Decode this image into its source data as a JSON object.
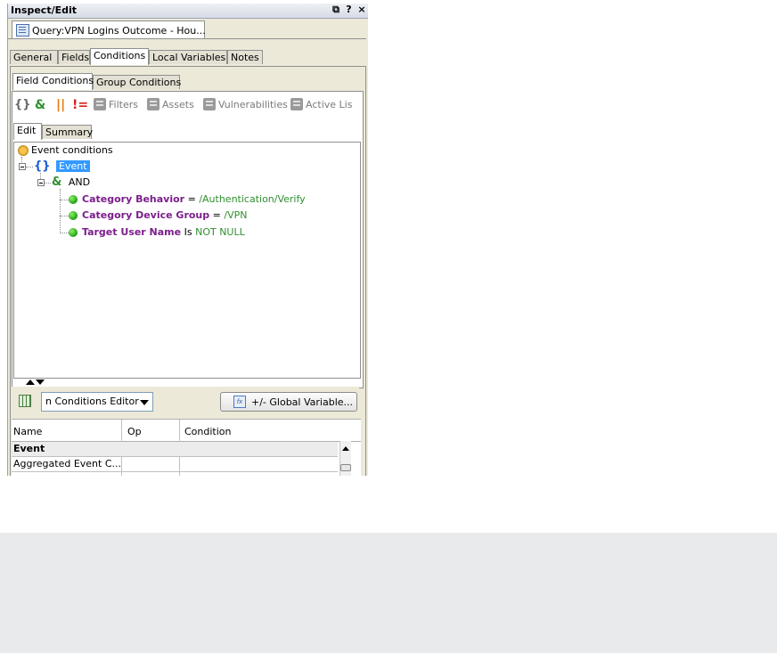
{
  "window": {
    "title": "Inspect/Edit",
    "controls": [
      "⧉",
      "?",
      "×"
    ]
  },
  "document_tab": {
    "label": "Query:VPN Logins Outcome - Hou..."
  },
  "main_tabs": [
    {
      "label": "General",
      "active": false
    },
    {
      "label": "Fields",
      "active": false
    },
    {
      "label": "Conditions",
      "active": true
    },
    {
      "label": "Local Variables",
      "active": false
    },
    {
      "label": "Notes",
      "active": false
    }
  ],
  "condition_tabs": [
    {
      "label": "Field Conditions",
      "active": true
    },
    {
      "label": "Group Conditions",
      "active": false
    }
  ],
  "toolbar": {
    "braces_glyph": "{}",
    "and_glyph": "&",
    "or_glyph": "||",
    "not_glyph": "!=",
    "filters_label": "Filters",
    "assets_label": "Assets",
    "vulnerabilities_label": "Vulnerabilities",
    "active_lists_label": "Active Lis"
  },
  "edit_tabs": [
    {
      "label": "Edit",
      "active": true
    },
    {
      "label": "Summary",
      "active": false
    }
  ],
  "tree": {
    "root_label": "Event conditions",
    "event_glyph": "{}",
    "event_label": "Event",
    "and_glyph": "&",
    "and_label": "AND",
    "conditions": [
      {
        "field": "Category Behavior",
        "op": "=",
        "value": "/Authentication/Verify"
      },
      {
        "field": "Category Device Group",
        "op": "=",
        "value": "/VPN"
      },
      {
        "field": "Target User Name",
        "op": "Is",
        "value": "NOT NULL"
      }
    ]
  },
  "bottom": {
    "editor_selector": "n Conditions Editor",
    "global_variable_button": "+/- Global Variable...",
    "global_variable_icon": "fx"
  },
  "grid": {
    "columns": [
      "Name",
      "Op",
      "Condition"
    ],
    "group_label": "Event",
    "rows": [
      {
        "name": "Aggregated Event C...",
        "op": "",
        "condition": ""
      }
    ]
  },
  "colors": {
    "field_name": "#7b1f8a",
    "value": "#2f8f2f",
    "selection": "#3399ff",
    "panel_bg": "#ece9d8"
  }
}
